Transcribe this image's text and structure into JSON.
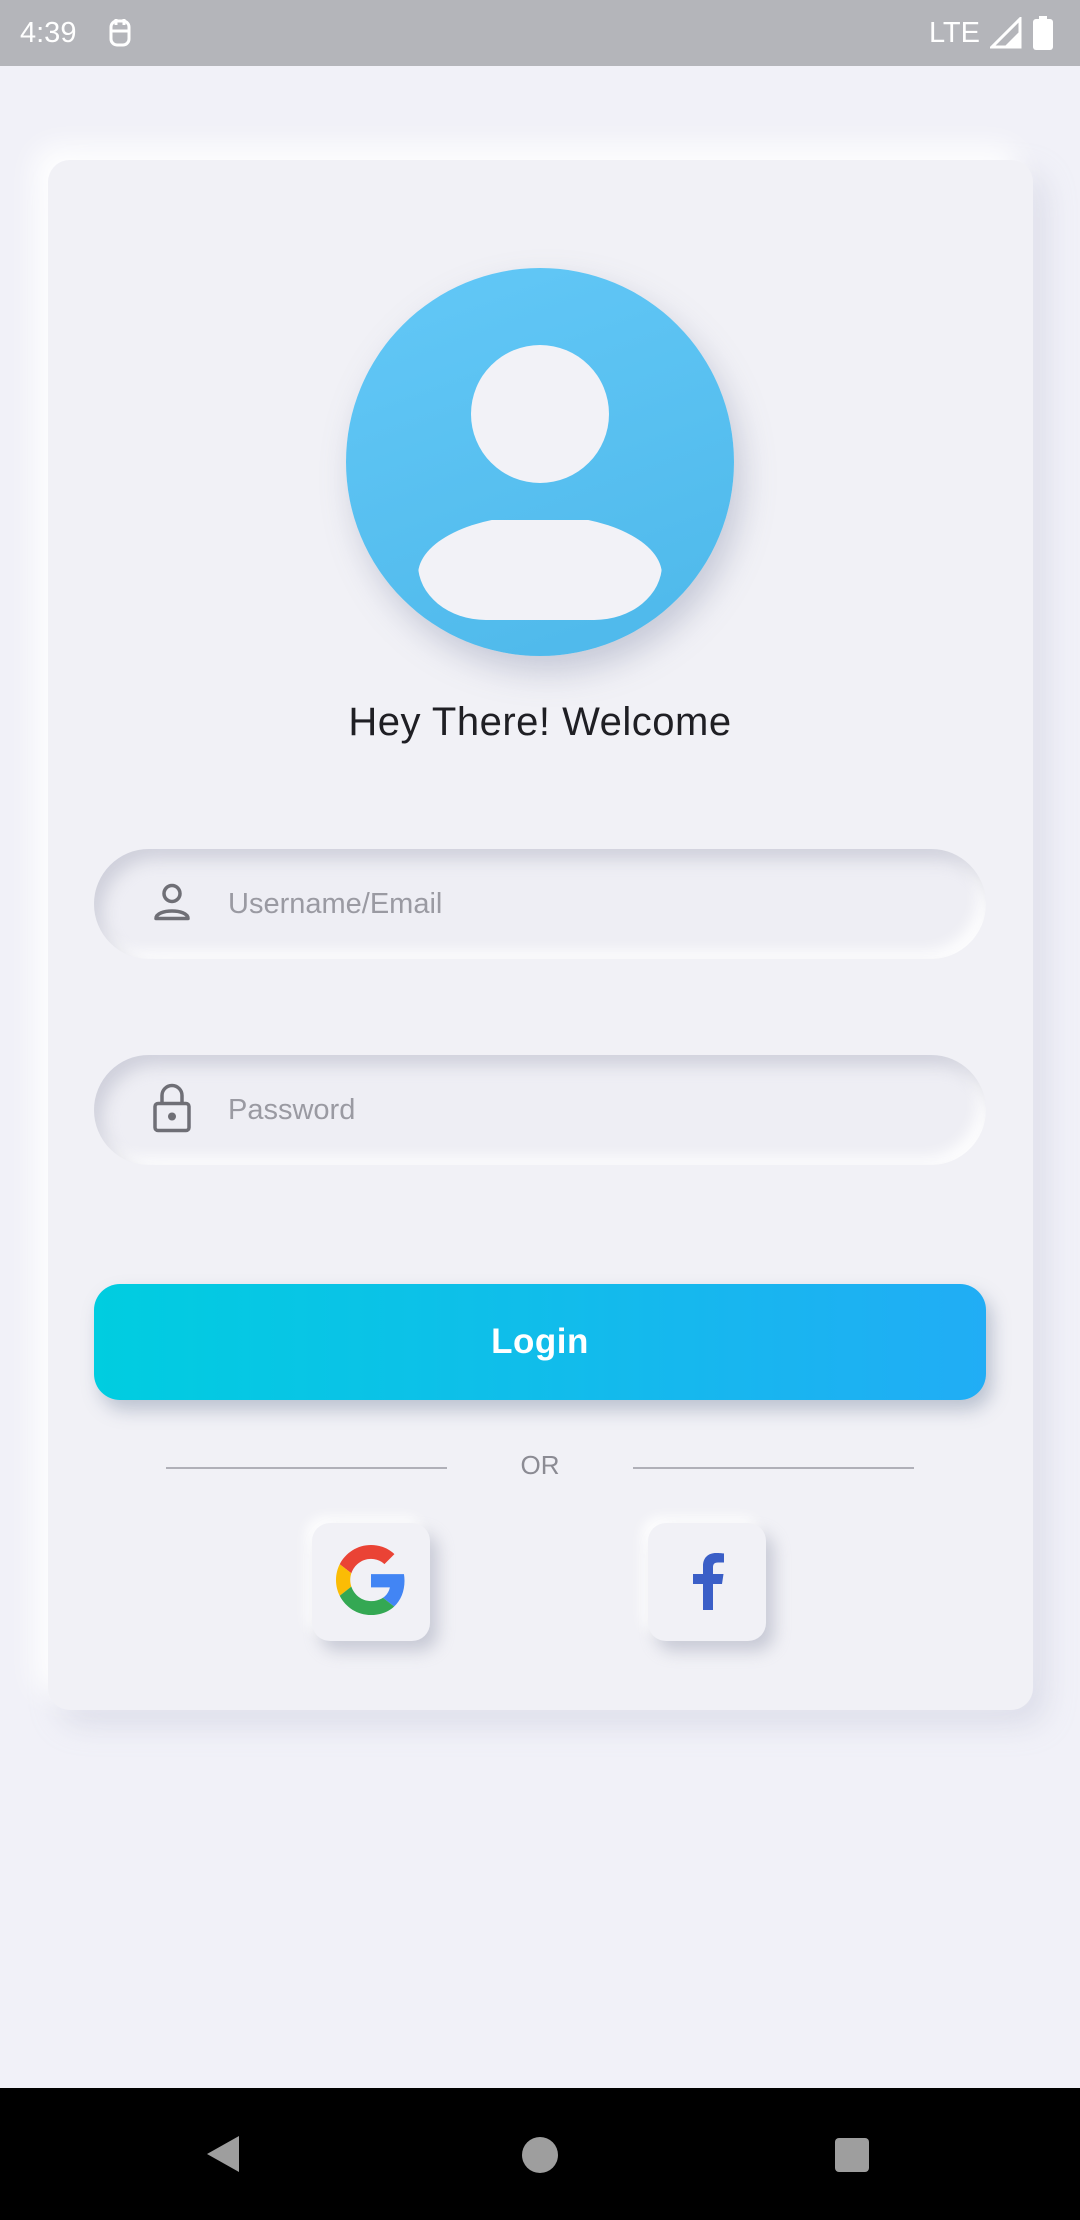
{
  "status_bar": {
    "time": "4:39",
    "network": "LTE",
    "icons": [
      "notification-icon",
      "signal-icon",
      "battery-icon"
    ]
  },
  "welcome_text": "Hey There! Welcome",
  "username_field": {
    "placeholder": "Username/Email",
    "value": "",
    "icon": "person-icon"
  },
  "password_field": {
    "placeholder": "Password",
    "value": "",
    "icon": "lock-icon"
  },
  "login_button": {
    "label": "Login"
  },
  "divider": {
    "label": "OR"
  },
  "social": {
    "google_icon": "google-logo-icon",
    "facebook_icon": "facebook-logo-icon"
  },
  "colors": {
    "avatar": "#52bbee",
    "login_gradient_start": "#00cde0",
    "login_gradient_end": "#21adf5",
    "facebook_blue": "#3b5fc7",
    "background": "#f1f1f8"
  },
  "nav_bar": {
    "icons": [
      "back-icon",
      "home-icon",
      "recents-icon"
    ]
  }
}
